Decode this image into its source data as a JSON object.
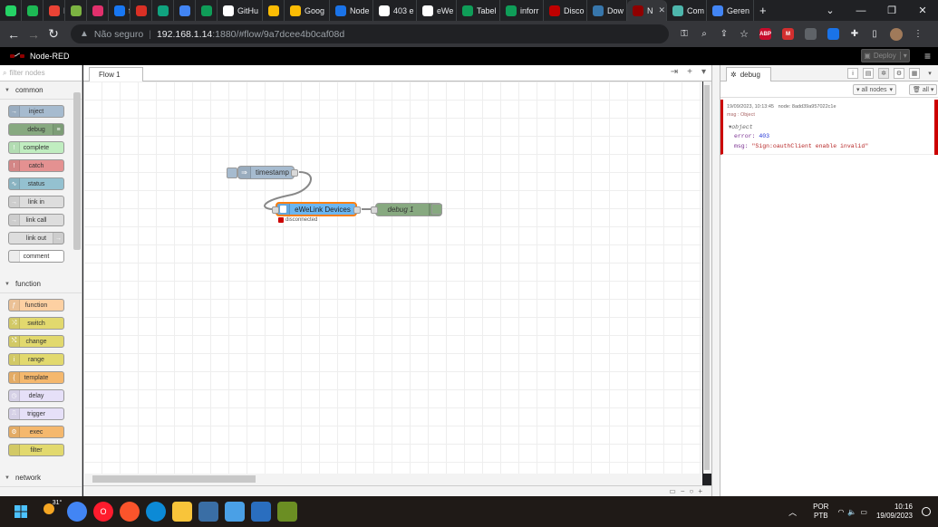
{
  "browser": {
    "tabs": [
      {
        "label": "",
        "color": "#25d366",
        "icon": "whatsapp-icon"
      },
      {
        "label": "",
        "color": "#1db954",
        "icon": "spotify-icon"
      },
      {
        "label": "M",
        "color": "#ea4335",
        "icon": "gmail-icon"
      },
      {
        "label": "",
        "color": "#7cb342",
        "icon": "android-icon"
      },
      {
        "label": "",
        "color": "#e1306c",
        "icon": "instagram-icon"
      },
      {
        "label": "f",
        "color": "#1877f2",
        "icon": "facebook-icon"
      },
      {
        "label": "",
        "color": "#d93025",
        "icon": "app-icon"
      },
      {
        "label": "",
        "color": "#10a37f",
        "icon": "chatgpt-icon"
      },
      {
        "label": "",
        "color": "#4285f4",
        "icon": "bard-icon"
      },
      {
        "label": "",
        "color": "#0f9d58",
        "icon": "sheets-icon"
      },
      {
        "label": "GitHu",
        "color": "#ffffff",
        "icon": "github-icon"
      },
      {
        "label": "",
        "color": "#fbbc04",
        "icon": "circle-icon"
      },
      {
        "label": "Goog",
        "color": "#fbbc04",
        "icon": "google-icon"
      },
      {
        "label": "Node",
        "color": "#1a73e8",
        "icon": "node-icon"
      },
      {
        "label": "403 e",
        "color": "#ffffff",
        "icon": "github-icon"
      },
      {
        "label": "eWe",
        "color": "#ffffff",
        "icon": "ewelink-icon"
      },
      {
        "label": "Tabel",
        "color": "#0f9d58",
        "icon": "sheets-icon"
      },
      {
        "label": "inforr",
        "color": "#0f9d58",
        "icon": "sheets-icon"
      },
      {
        "label": "Disco",
        "color": "#c00000",
        "icon": "discourse-icon"
      },
      {
        "label": "Dow",
        "color": "#3776ab",
        "icon": "python-icon"
      },
      {
        "label": "N",
        "color": "#8f0000",
        "icon": "nodered-icon",
        "active": true
      },
      {
        "label": "Com",
        "color": "#4db6ac",
        "icon": "community-icon"
      },
      {
        "label": "Geren",
        "color": "#4285f4",
        "icon": "google-icon"
      }
    ],
    "new_tab": "+",
    "window_controls": [
      "⌄",
      "—",
      "❐",
      "✕"
    ],
    "nav": {
      "back": "←",
      "forward": "→",
      "reload": "↻"
    },
    "url": {
      "security": "Não seguro",
      "host": "192.168.1.14",
      "rest": ":1880/#flow/9a7dcee4b0caf08d"
    },
    "extensions": [
      {
        "label": "ABP",
        "color": "#c70d2c"
      },
      {
        "label": "M",
        "color": "#d32f2f"
      },
      {
        "label": "",
        "color": "#5f6368"
      },
      {
        "label": "",
        "color": "#1a73e8"
      }
    ]
  },
  "nodered": {
    "title": "Node-RED",
    "deploy_label": "Deploy",
    "palette": {
      "filter_placeholder": "filter nodes",
      "categories": [
        {
          "name": "common",
          "nodes": [
            {
              "label": "inject",
              "color": "#a6bbcf",
              "icon": "→",
              "icon_side": "left"
            },
            {
              "label": "debug",
              "color": "#87a980",
              "icon": "≡",
              "icon_side": "right"
            },
            {
              "label": "complete",
              "color": "#c0edc0",
              "icon": "!",
              "icon_side": "left"
            },
            {
              "label": "catch",
              "color": "#e49191",
              "icon": "!",
              "icon_side": "left"
            },
            {
              "label": "status",
              "color": "#94c1d0",
              "icon": "∿",
              "icon_side": "left"
            },
            {
              "label": "link in",
              "color": "#dddddd",
              "icon": "→",
              "icon_side": "left"
            },
            {
              "label": "link call",
              "color": "#dddddd",
              "icon": "→",
              "icon_side": "left"
            },
            {
              "label": "link out",
              "color": "#dddddd",
              "icon": "→",
              "icon_side": "right"
            },
            {
              "label": "comment",
              "color": "#ffffff",
              "icon": "",
              "icon_side": "left"
            }
          ]
        },
        {
          "name": "function",
          "nodes": [
            {
              "label": "function",
              "color": "#fdd0a2",
              "icon": "ƒ",
              "icon_side": "left"
            },
            {
              "label": "switch",
              "color": "#e2d96e",
              "icon": "⤨",
              "icon_side": "left"
            },
            {
              "label": "change",
              "color": "#e2d96e",
              "icon": "⤭",
              "icon_side": "left"
            },
            {
              "label": "range",
              "color": "#e2d96e",
              "icon": "i",
              "icon_side": "left"
            },
            {
              "label": "template",
              "color": "#f5b86d",
              "icon": "{",
              "icon_side": "left"
            },
            {
              "label": "delay",
              "color": "#e6e0f8",
              "icon": "◷",
              "icon_side": "left"
            },
            {
              "label": "trigger",
              "color": "#e6e0f8",
              "icon": "⎍",
              "icon_side": "left"
            },
            {
              "label": "exec",
              "color": "#f5b86d",
              "icon": "⚙",
              "icon_side": "left"
            },
            {
              "label": "filter",
              "color": "#e2d96e",
              "icon": "",
              "icon_side": "left"
            }
          ]
        },
        {
          "name": "network",
          "nodes": []
        }
      ]
    },
    "workspace": {
      "tab_label": "Flow 1",
      "nodes": [
        {
          "id": "timestamp",
          "label": "timestamp",
          "color": "#a6bbcf"
        },
        {
          "id": "ewelink",
          "label": "eWeLink Devices",
          "color": "#6cb6f0",
          "status": "disconnected",
          "status_color": "#cc0000"
        },
        {
          "id": "debug",
          "label": "debug 1",
          "color": "#87a980"
        }
      ]
    },
    "sidebar": {
      "tab_label": "debug",
      "filter_label": "all nodes",
      "clear_label": "all",
      "message": {
        "timestamp": "19/09/2023, 10:13:45",
        "node": "node: 8add39a957022c1e",
        "topic": "msg : Object",
        "object_label": "object",
        "error_key": "error:",
        "error_value": "403",
        "msg_key": "msg:",
        "msg_value": "\"Sign:oauthClient enable invalid\""
      }
    }
  },
  "taskbar": {
    "weather": "31°",
    "apps": [
      {
        "name": "chrome",
        "color": "#4285f4",
        "label": ""
      },
      {
        "name": "opera",
        "color": "#ff1b2d",
        "label": "O"
      },
      {
        "name": "brave",
        "color": "#fb542b",
        "label": ""
      },
      {
        "name": "edge",
        "color": "#0c8ad6",
        "label": ""
      },
      {
        "name": "explorer",
        "color": "#f8c43a",
        "label": ""
      },
      {
        "name": "photos",
        "color": "#3a6ea5",
        "label": ""
      },
      {
        "name": "notepad",
        "color": "#4aa0e6",
        "label": ""
      },
      {
        "name": "app",
        "color": "#2a6ebf",
        "label": ""
      },
      {
        "name": "app2",
        "color": "#6b8e23",
        "label": ""
      }
    ],
    "language": "POR",
    "keyboard": "PTB",
    "time": "10:16",
    "date": "19/09/2023"
  }
}
